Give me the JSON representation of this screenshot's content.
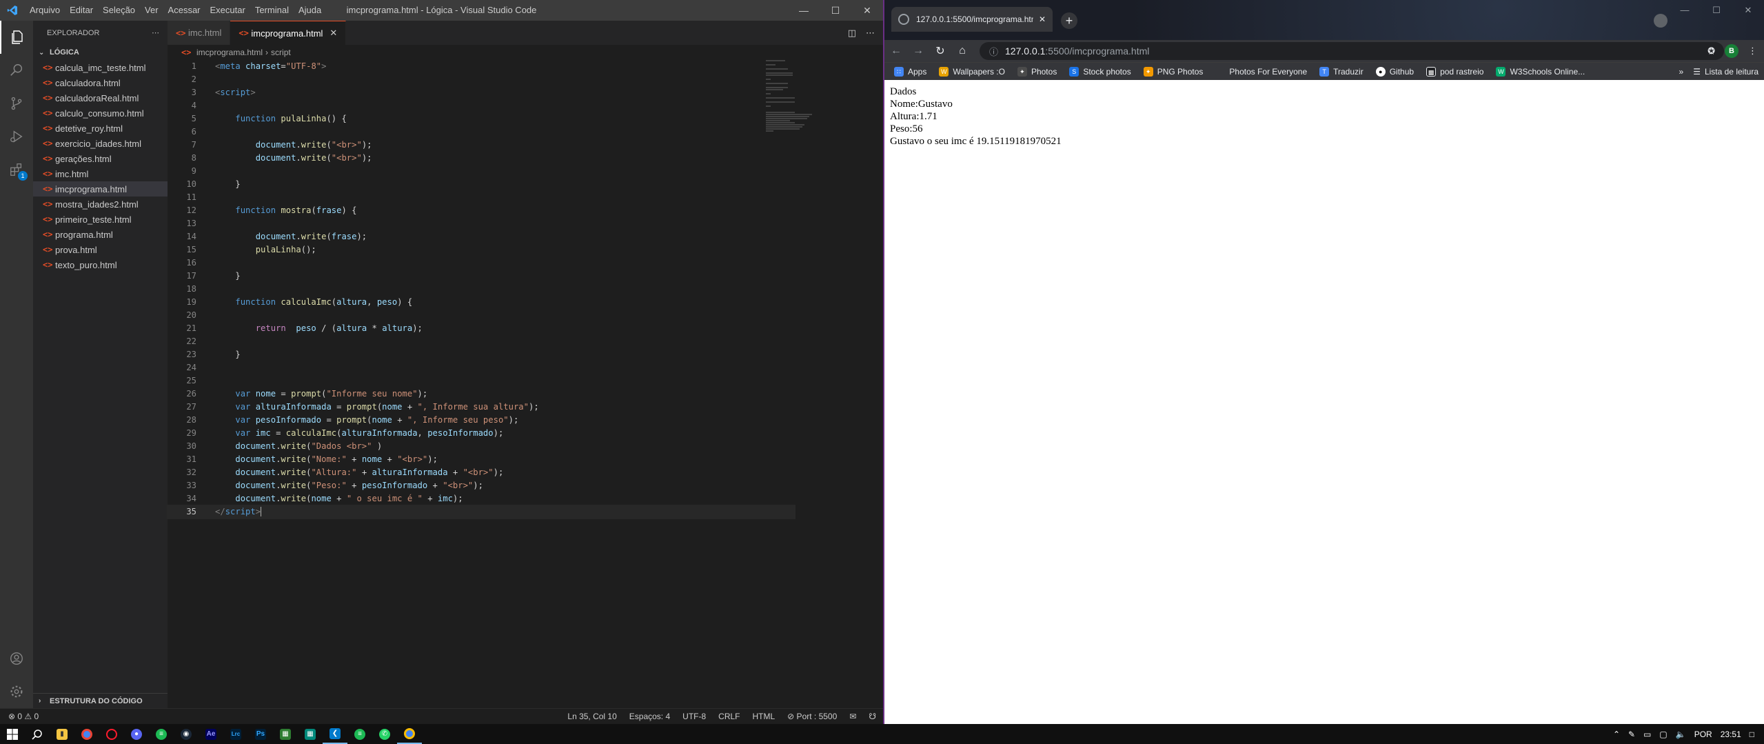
{
  "vscode": {
    "menu": [
      "Arquivo",
      "Editar",
      "Seleção",
      "Ver",
      "Acessar",
      "Executar",
      "Terminal",
      "Ajuda"
    ],
    "title": "imcprograma.html - Lógica - Visual Studio Code",
    "explorer_title": "EXPLORADOR",
    "folder": "LÓGICA",
    "files": [
      "calcula_imc_teste.html",
      "calculadora.html",
      "calculadoraReal.html",
      "calculo_consumo.html",
      "detetive_roy.html",
      "exercicio_idades.html",
      "gerações.html",
      "imc.html",
      "imcprograma.html",
      "mostra_idades2.html",
      "primeiro_teste.html",
      "programa.html",
      "prova.html",
      "texto_puro.html"
    ],
    "outline": "ESTRUTURA DO CÓDIGO",
    "tabs": [
      {
        "label": "imc.html",
        "active": false
      },
      {
        "label": "imcprograma.html",
        "active": true
      }
    ],
    "breadcrumb": [
      "imcprograma.html",
      "script"
    ],
    "extensions_badge": "1",
    "code_lines": [
      "1",
      "2",
      "3",
      "4",
      "5",
      "6",
      "7",
      "8",
      "9",
      "10",
      "11",
      "12",
      "13",
      "14",
      "15",
      "16",
      "17",
      "18",
      "19",
      "20",
      "21",
      "22",
      "23",
      "24",
      "25",
      "26",
      "27",
      "28",
      "29",
      "30",
      "31",
      "32",
      "33",
      "34",
      "35"
    ],
    "status": {
      "problems": "⊗ 0 ⚠ 0",
      "position": "Ln 35, Col 10",
      "spaces": "Espaços: 4",
      "encoding": "UTF-8",
      "eol": "CRLF",
      "language": "HTML",
      "port": "⊘ Port : 5500"
    }
  },
  "browser": {
    "tab_title": "127.0.0.1:5500/imcprograma.htm",
    "url_host": "127.0.0.1",
    "url_path": ":5500/imcprograma.html",
    "bookmarks": [
      "Apps",
      "Wallpapers :O",
      "Photos",
      "Stock photos",
      "PNG Photos",
      "Photos For Everyone",
      "Traduzir",
      "Github",
      "pod rastreio",
      "W3Schools Online..."
    ],
    "reading_list": "Lista de leitura",
    "profile_initial": "B",
    "output_lines": [
      "Dados",
      "Nome:Gustavo",
      "Altura:1.71",
      "Peso:56",
      "Gustavo o seu imc é 19.15119181970521"
    ]
  },
  "taskbar": {
    "lang": "POR",
    "time": "23:51"
  }
}
